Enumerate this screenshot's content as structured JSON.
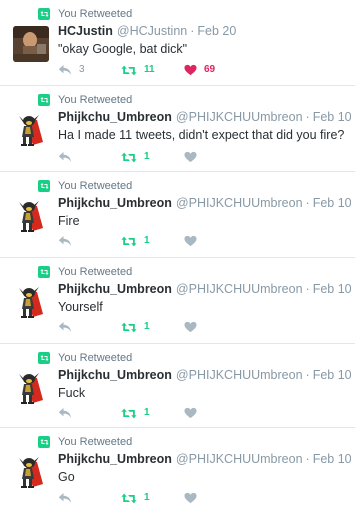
{
  "colors": {
    "retweet_green": "#19cf86",
    "like_red": "#e0245e",
    "icon_gray": "#aab8c2",
    "muted_text": "#8899a6"
  },
  "icons": {
    "retweeted_badge": "retweet-icon",
    "reply": "reply-icon",
    "retweet": "retweet-icon",
    "like": "heart-icon"
  },
  "tweets": [
    {
      "retweeted_label": "You Retweeted",
      "name": "HCJustin",
      "handle": "@HCJustinn",
      "dot": "·",
      "time": "Feb 20",
      "text": "\"okay Google, bat dick\"",
      "reply_count": "3",
      "retweet_count": "11",
      "like_count": "69",
      "liked": true,
      "avatar": "photo"
    },
    {
      "retweeted_label": "You Retweeted",
      "name": "Phijkchu_Umbreon",
      "handle": "@PHIJKCHUUmbreon",
      "dot": "·",
      "time": "Feb 10",
      "text": "Ha I made 11 tweets, didn't expect that did you fire?",
      "retweet_count": "1",
      "liked": false,
      "avatar": "character"
    },
    {
      "retweeted_label": "You Retweeted",
      "name": "Phijkchu_Umbreon",
      "handle": "@PHIJKCHUUmbreon",
      "dot": "·",
      "time": "Feb 10",
      "text": "Fire",
      "retweet_count": "1",
      "liked": false,
      "avatar": "character"
    },
    {
      "retweeted_label": "You Retweeted",
      "name": "Phijkchu_Umbreon",
      "handle": "@PHIJKCHUUmbreon",
      "dot": "·",
      "time": "Feb 10",
      "text": "Yourself",
      "retweet_count": "1",
      "liked": false,
      "avatar": "character"
    },
    {
      "retweeted_label": "You Retweeted",
      "name": "Phijkchu_Umbreon",
      "handle": "@PHIJKCHUUmbreon",
      "dot": "·",
      "time": "Feb 10",
      "text": "Fuck",
      "retweet_count": "1",
      "liked": false,
      "avatar": "character"
    },
    {
      "retweeted_label": "You Retweeted",
      "name": "Phijkchu_Umbreon",
      "handle": "@PHIJKCHUUmbreon",
      "dot": "·",
      "time": "Feb 10",
      "text": "Go",
      "retweet_count": "1",
      "liked": false,
      "avatar": "character"
    }
  ]
}
